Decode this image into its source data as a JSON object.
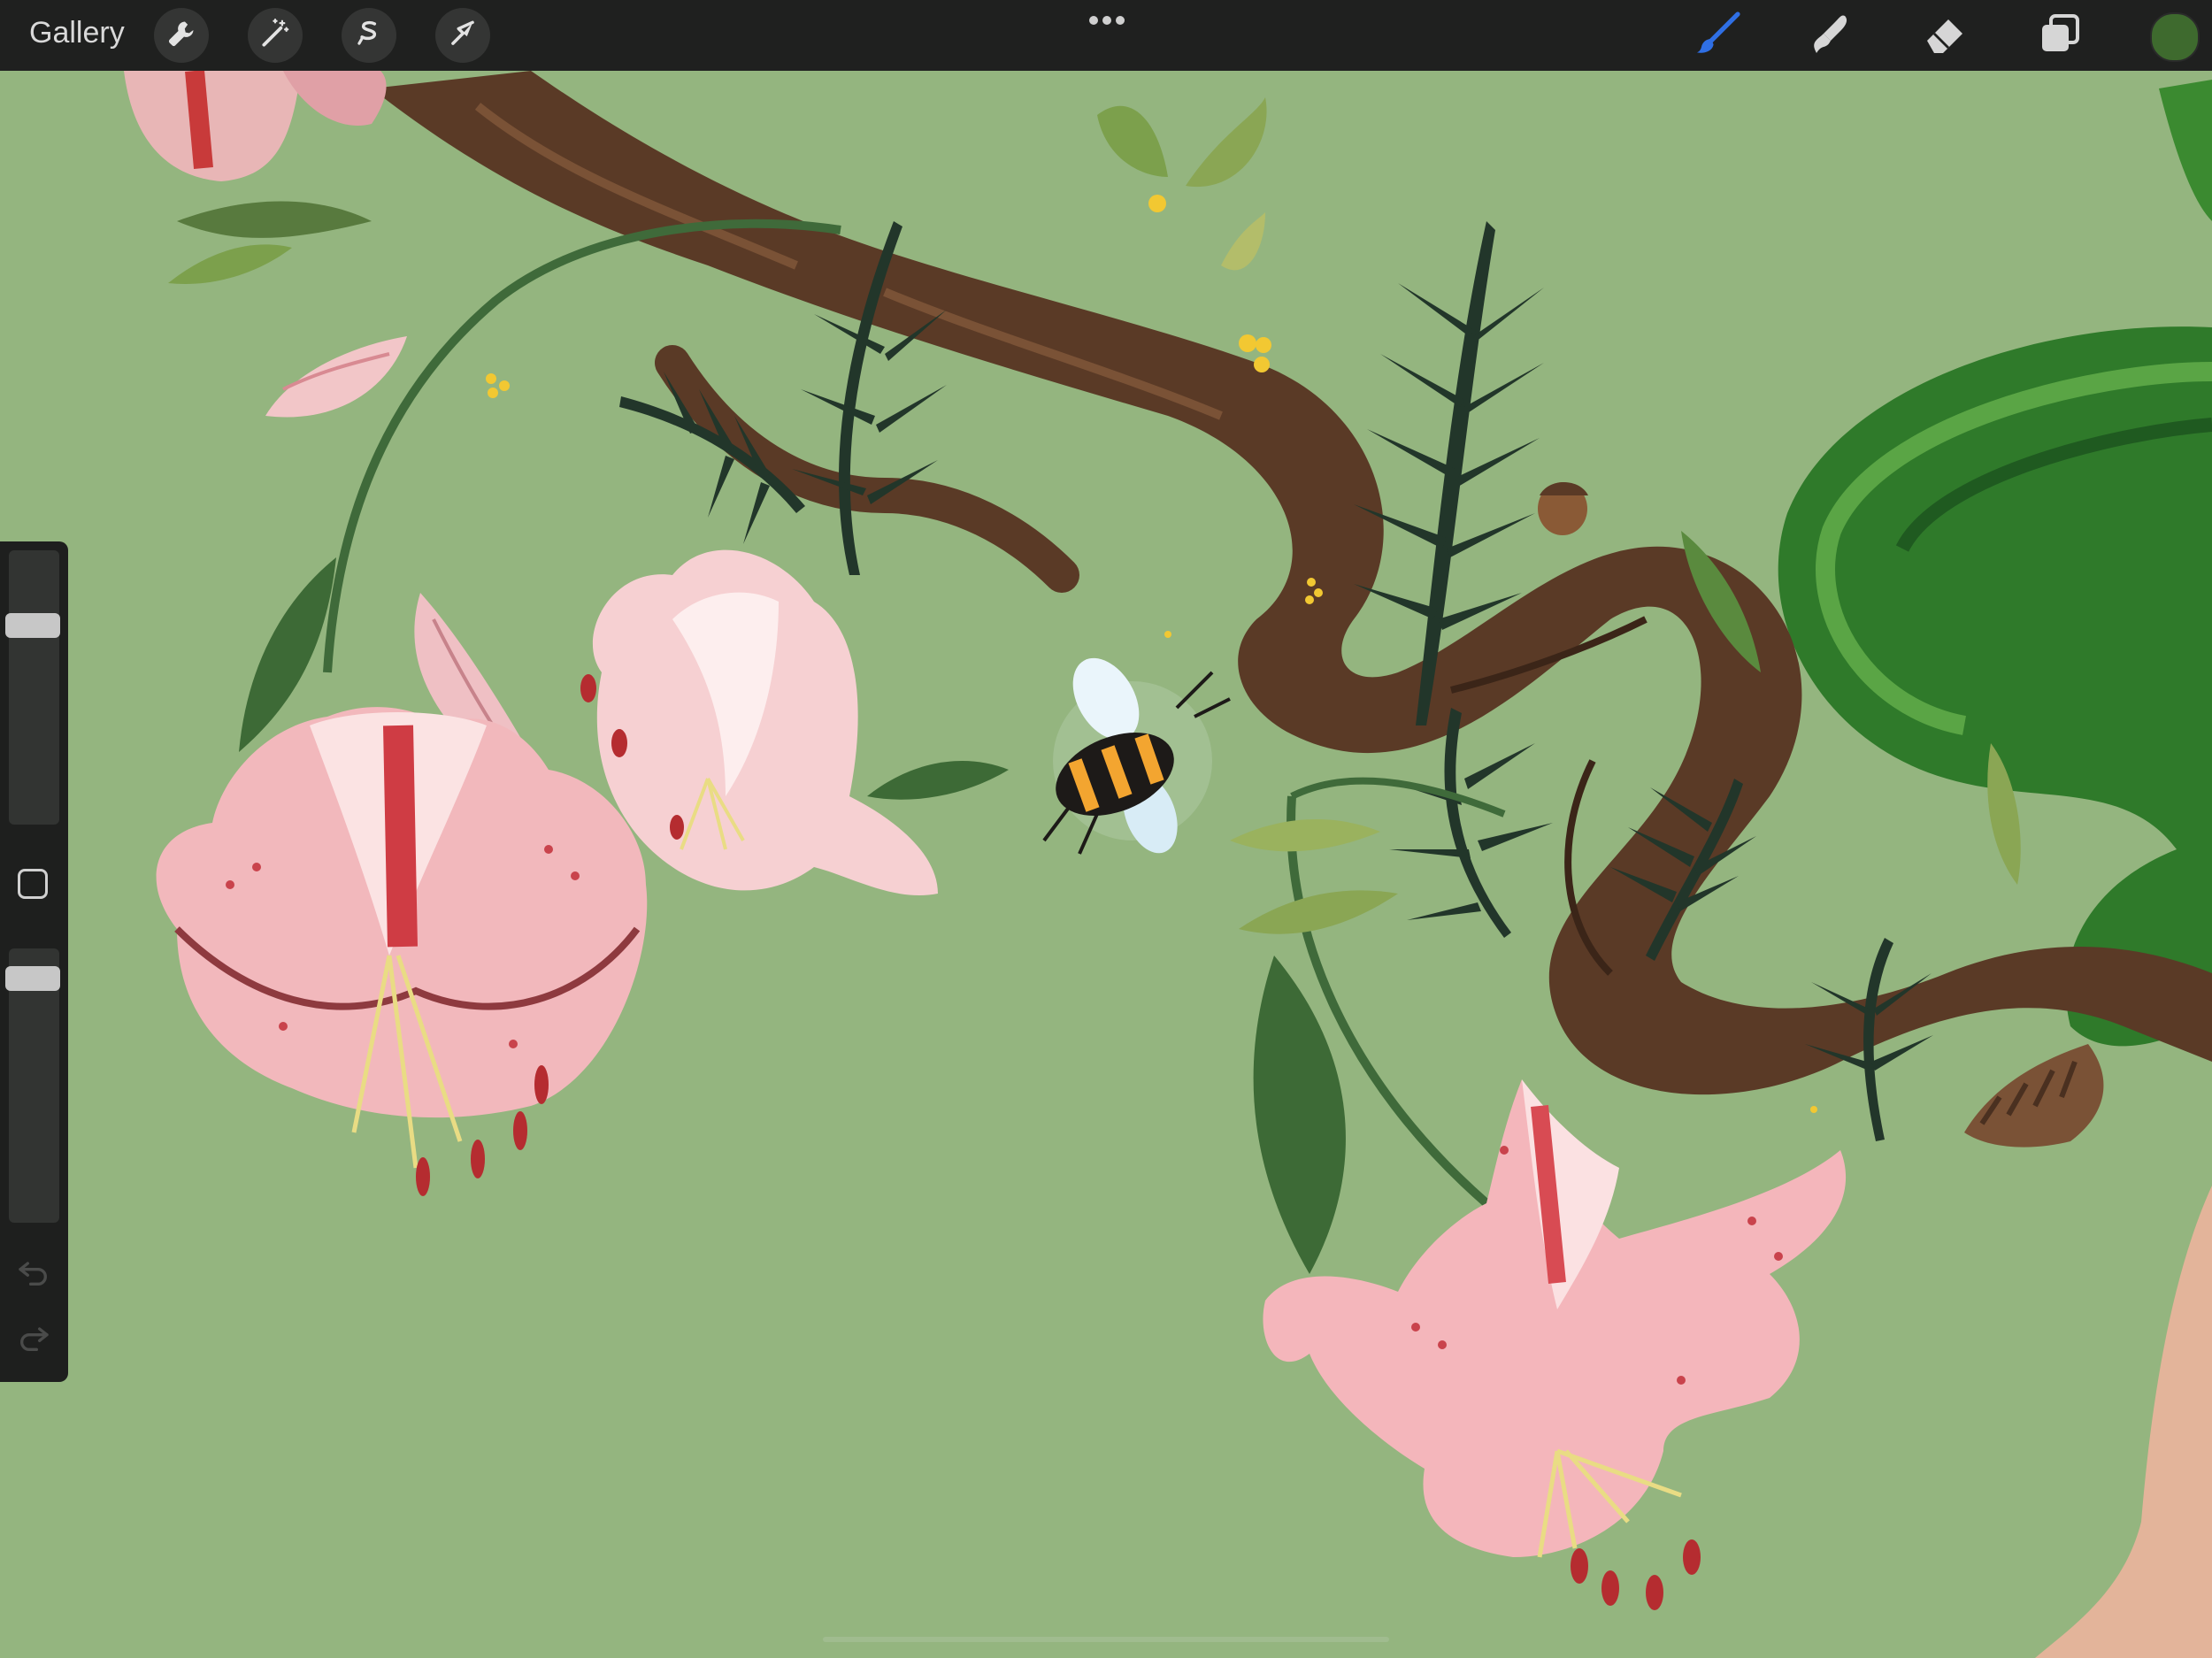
{
  "app": {
    "gallery_label": "Gallery"
  },
  "toolbar": {
    "left_tools": [
      {
        "name": "actions",
        "icon": "wrench-icon"
      },
      {
        "name": "adjustments",
        "icon": "magic-wand-icon"
      },
      {
        "name": "selection",
        "icon": "selection-s-icon"
      },
      {
        "name": "transform",
        "icon": "arrow-cursor-icon"
      }
    ],
    "right_tools": [
      {
        "name": "brush",
        "icon": "brush-icon",
        "active": true
      },
      {
        "name": "smudge",
        "icon": "smudge-icon",
        "active": false
      },
      {
        "name": "eraser",
        "icon": "eraser-icon",
        "active": false
      },
      {
        "name": "layers",
        "icon": "layers-icon",
        "active": false
      }
    ],
    "current_color": "#3e6a2e",
    "active_tool_color": "#2f6fe4"
  },
  "sidebar": {
    "brush_size_level": 0.75,
    "opacity_level": 0.93
  },
  "canvas": {
    "background_color": "#94b57f"
  }
}
